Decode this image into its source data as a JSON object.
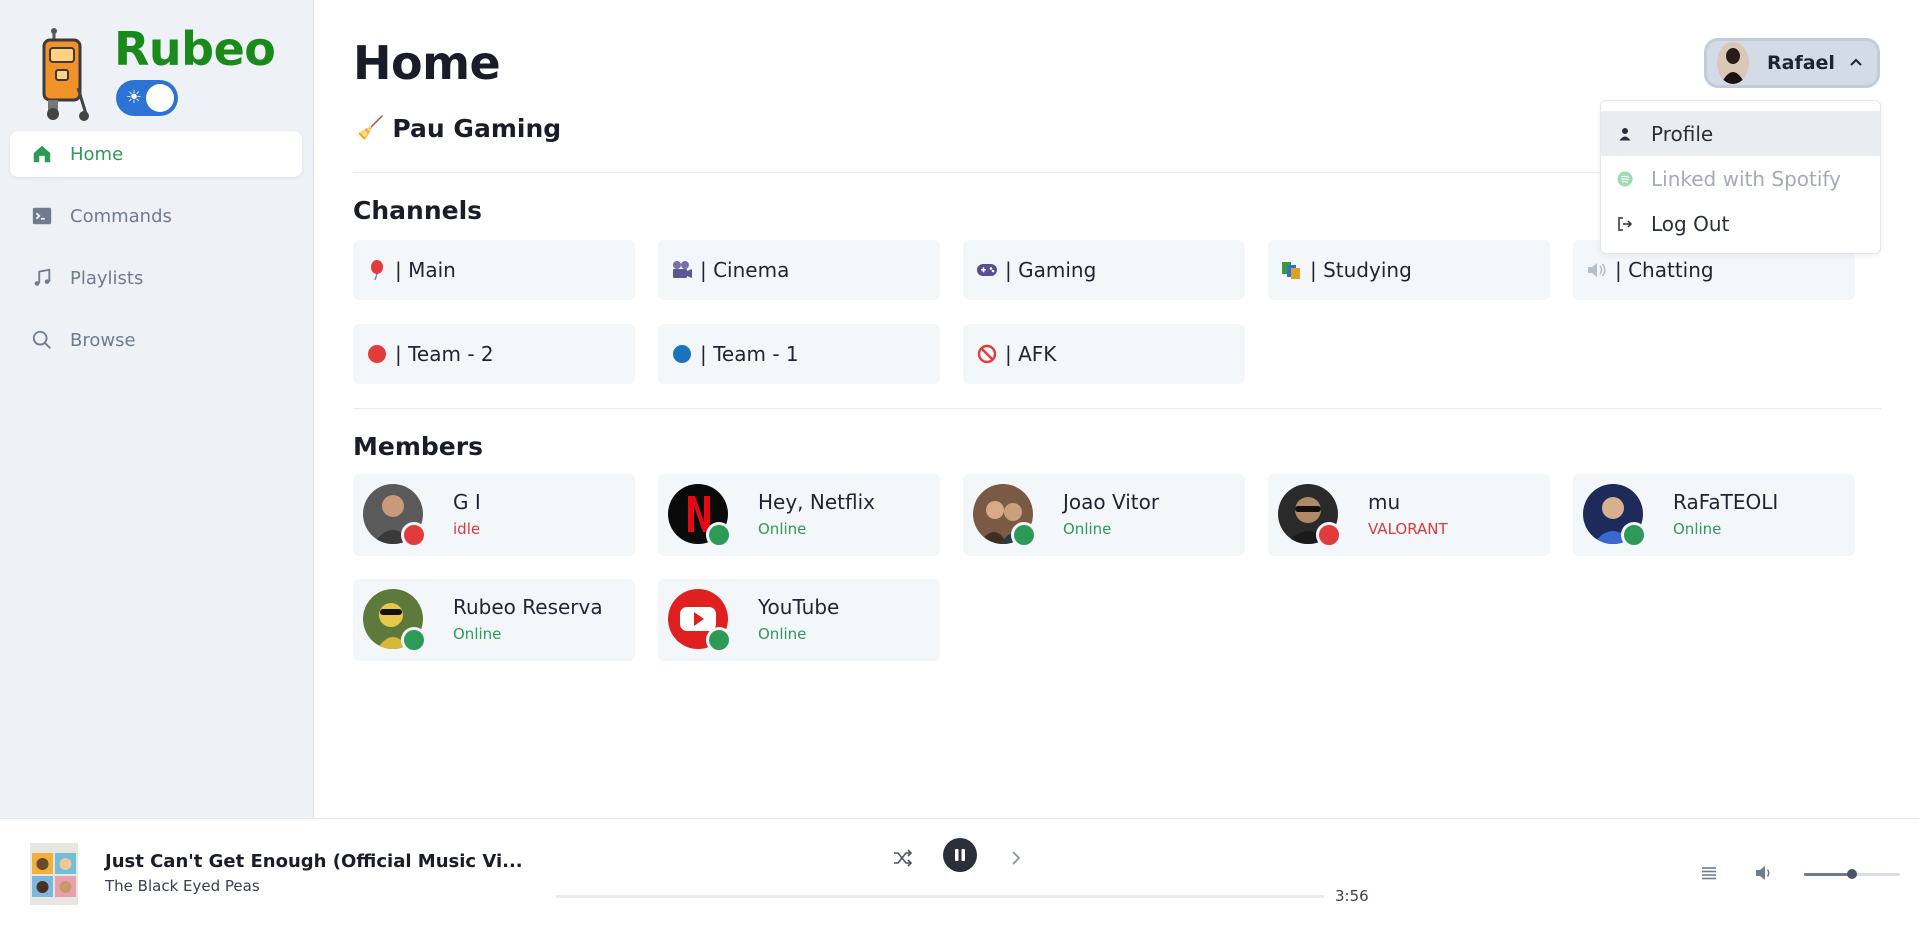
{
  "app": {
    "name": "Rubeo"
  },
  "sidebar": {
    "items": [
      {
        "label": "Home",
        "icon": "home-icon",
        "active": true
      },
      {
        "label": "Commands",
        "icon": "terminal-icon",
        "active": false
      },
      {
        "label": "Playlists",
        "icon": "music-note-icon",
        "active": false
      },
      {
        "label": "Browse",
        "icon": "search-icon",
        "active": false
      }
    ]
  },
  "page": {
    "title": "Home"
  },
  "server": {
    "emoji": "🧹",
    "name": "Pau Gaming"
  },
  "channels": {
    "title": "Channels",
    "items": [
      {
        "label": "| Main",
        "icon": "balloon-icon"
      },
      {
        "label": "| Cinema",
        "icon": "movie-camera-icon"
      },
      {
        "label": "| Gaming",
        "icon": "gamepad-icon"
      },
      {
        "label": "| Studying",
        "icon": "books-icon"
      },
      {
        "label": "| Chatting",
        "icon": "speaker-icon"
      },
      {
        "label": "| Team - 2",
        "icon": "red-circle-icon"
      },
      {
        "label": "| Team - 1",
        "icon": "blue-circle-icon"
      },
      {
        "label": "| AFK",
        "icon": "prohibited-icon"
      }
    ]
  },
  "members": {
    "title": "Members",
    "items": [
      {
        "name": "G I",
        "status": "idle",
        "status_color": "#d93a3a"
      },
      {
        "name": "Hey, Netflix",
        "status": "Online",
        "status_color": "#2e9a58"
      },
      {
        "name": "Joao Vitor",
        "status": "Online",
        "status_color": "#2e9a58"
      },
      {
        "name": "mu",
        "status": "VALORANT",
        "status_color": "#d93a3a"
      },
      {
        "name": "RaFaTEOLI",
        "status": "Online",
        "status_color": "#2e9a58"
      },
      {
        "name": "Rubeo Reserva",
        "status": "Online",
        "status_color": "#2e9a58"
      },
      {
        "name": "YouTube",
        "status": "Online",
        "status_color": "#2e9a58"
      }
    ]
  },
  "user": {
    "name": "Rafael",
    "menu": [
      {
        "label": "Profile",
        "icon": "person-icon"
      },
      {
        "label": "Linked with Spotify",
        "icon": "spotify-icon",
        "disabled": true
      },
      {
        "label": "Log Out",
        "icon": "logout-icon"
      }
    ]
  },
  "player": {
    "title": "Just Can't Get Enough (Official Music Vi...",
    "artist": "The Black Eyed Peas",
    "duration": "3:56",
    "progress": 0.0,
    "volume": 0.5
  },
  "colors": {
    "accent": "#2e9a58",
    "brand": "#1a8a1a",
    "toggle": "#2d73d6",
    "danger": "#d93a3a"
  }
}
